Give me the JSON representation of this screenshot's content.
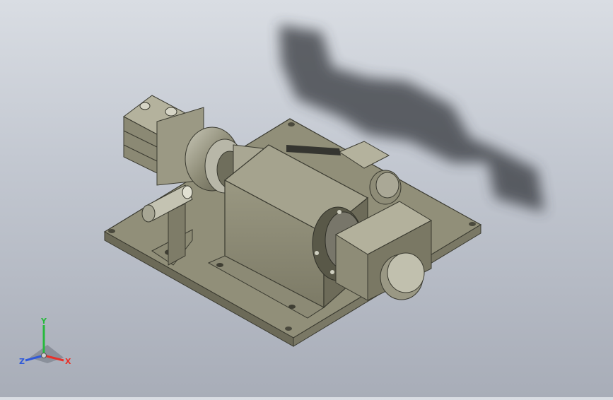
{
  "viewport": {
    "background_top": "#d9dde3",
    "background_bottom": "#a8adb8",
    "part_color": "#8e8c77",
    "part_dark": "#5f5e4f",
    "part_light": "#b9b7a2",
    "shadow_color": "#33363c"
  },
  "triad": {
    "x_label": "X",
    "y_label": "Y",
    "z_label": "Z",
    "x_color": "#e8312a",
    "y_color": "#27b93d",
    "z_color": "#2f59d9"
  }
}
